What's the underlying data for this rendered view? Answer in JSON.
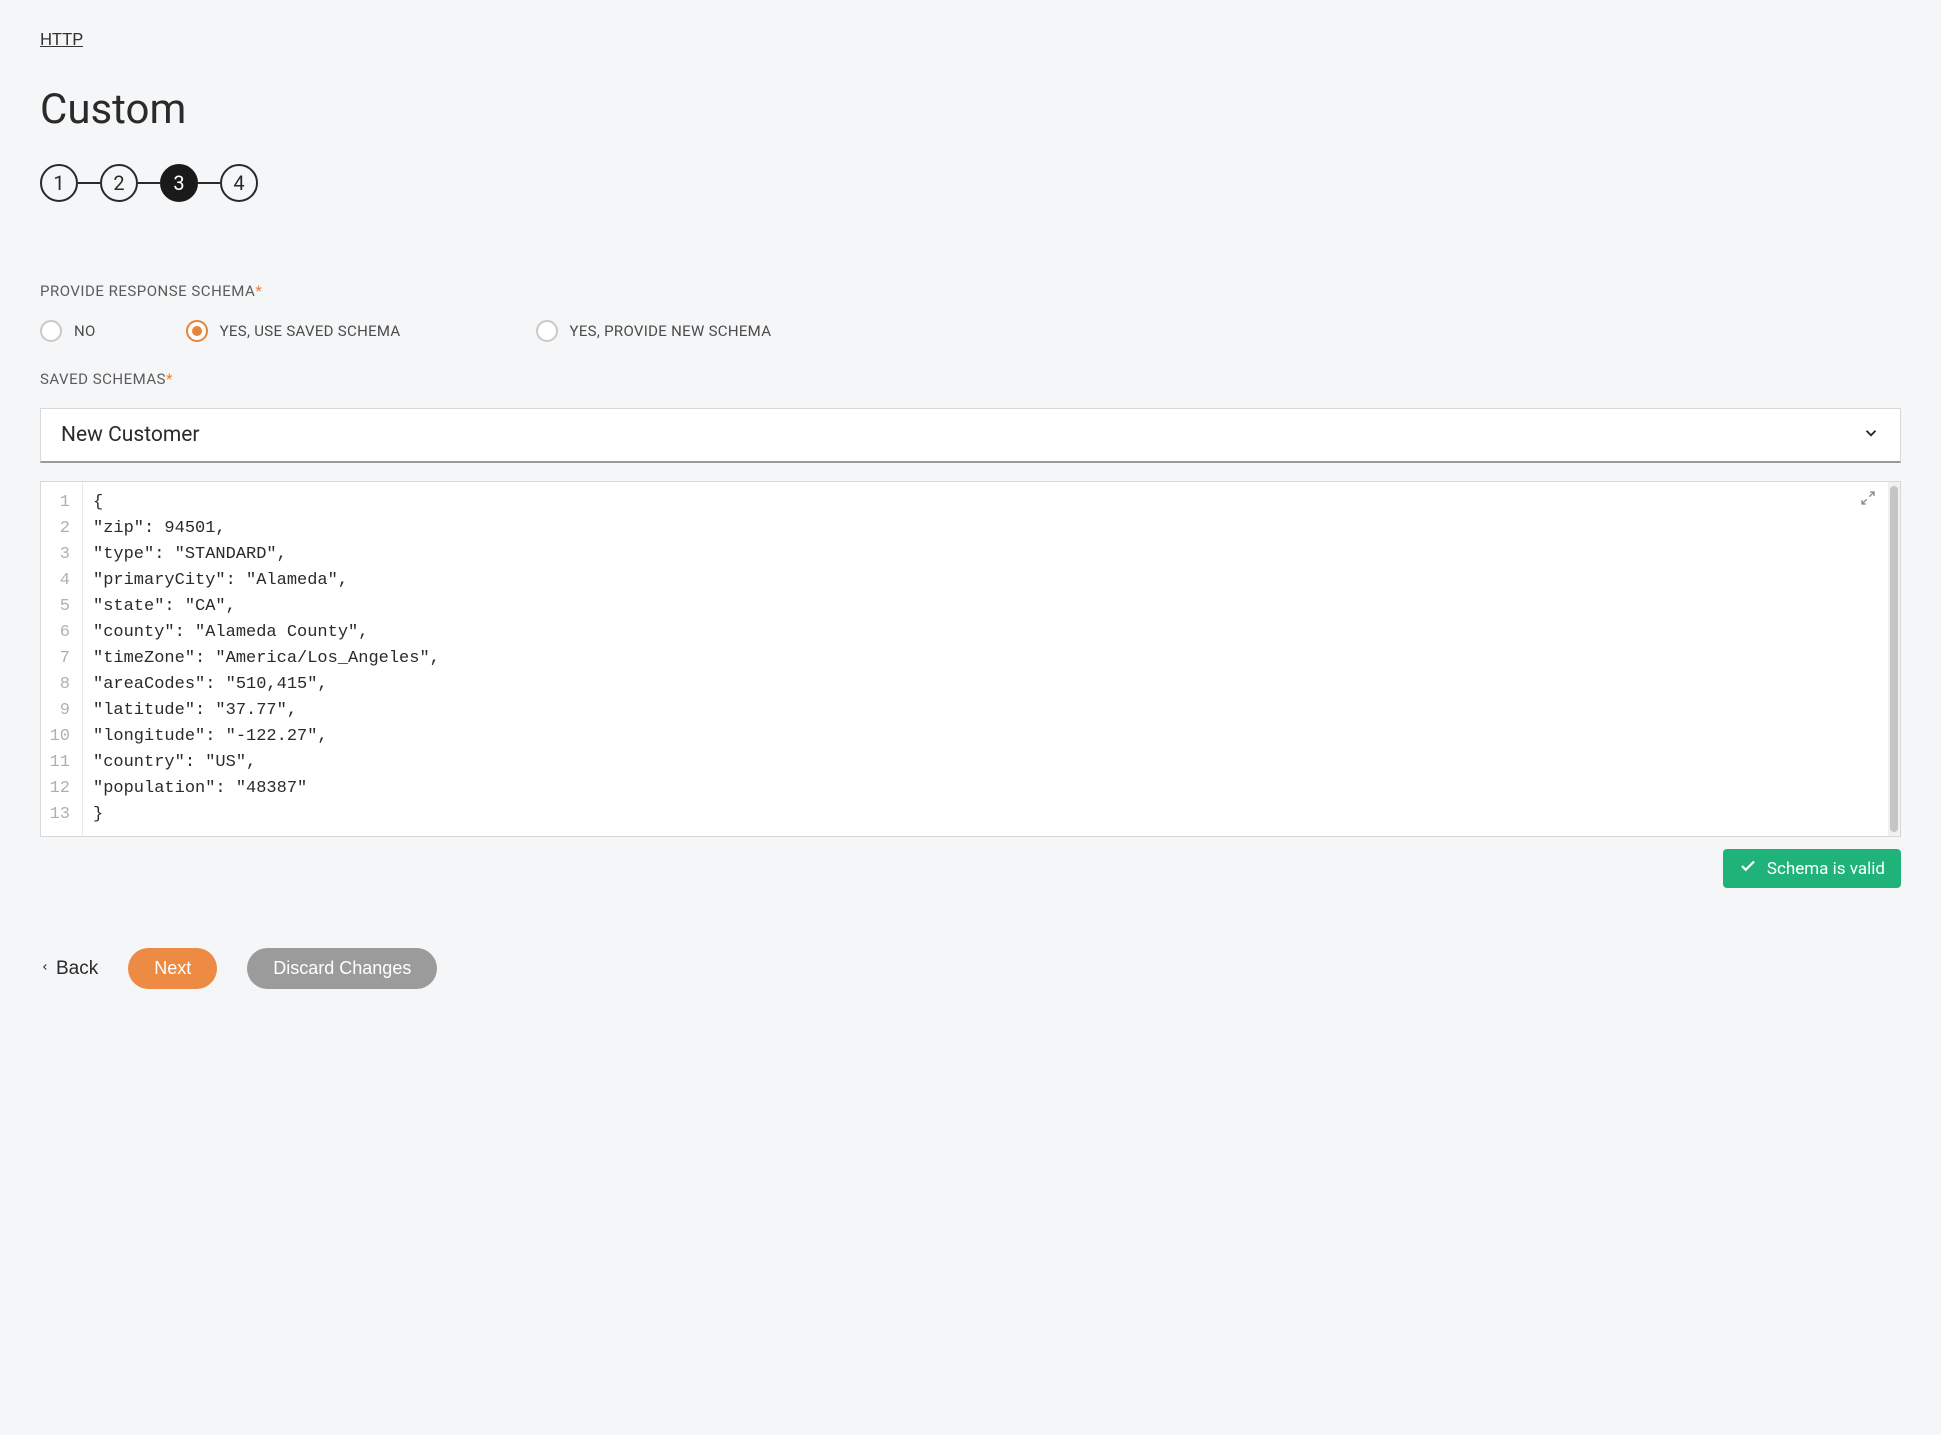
{
  "breadcrumb": "HTTP",
  "title": "Custom",
  "stepper": {
    "steps": [
      "1",
      "2",
      "3",
      "4"
    ],
    "activeIndex": 2
  },
  "schemaSection": {
    "provideLabel": "PROVIDE RESPONSE SCHEMA",
    "options": {
      "no": "NO",
      "useSaved": "YES, USE SAVED SCHEMA",
      "provideNew": "YES, PROVIDE NEW SCHEMA"
    },
    "selected": "useSaved",
    "savedLabel": "SAVED SCHEMAS",
    "savedValue": "New Customer"
  },
  "code": {
    "lines": [
      "{",
      "\"zip\": 94501,",
      "\"type\": \"STANDARD\",",
      "\"primaryCity\": \"Alameda\",",
      "\"state\": \"CA\",",
      "\"county\": \"Alameda County\",",
      "\"timeZone\": \"America/Los_Angeles\",",
      "\"areaCodes\": \"510,415\",",
      "\"latitude\": \"37.77\",",
      "\"longitude\": \"-122.27\",",
      "\"country\": \"US\",",
      "\"population\": \"48387\"",
      "}"
    ]
  },
  "validBadge": "Schema is valid",
  "footer": {
    "back": "Back",
    "next": "Next",
    "discard": "Discard Changes"
  }
}
